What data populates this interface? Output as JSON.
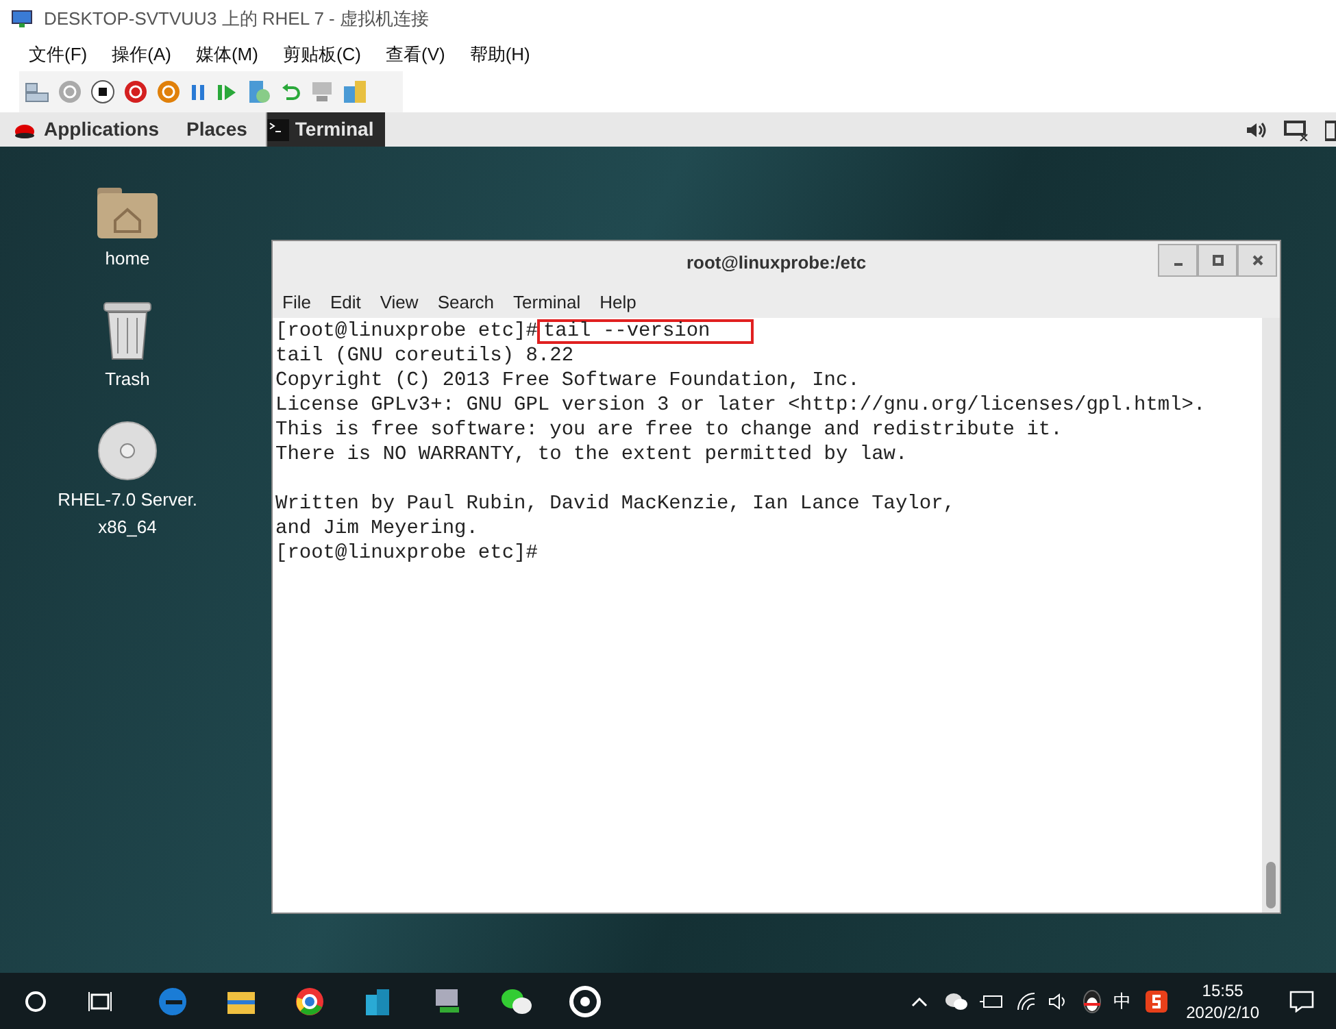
{
  "host_window": {
    "title": "DESKTOP-SVTVUU3 上的 RHEL 7 - 虚拟机连接",
    "menu": [
      "文件(F)",
      "操作(A)",
      "媒体(M)",
      "剪贴板(C)",
      "查看(V)",
      "帮助(H)"
    ]
  },
  "guest_top_bar": {
    "applications": "Applications",
    "places": "Places",
    "active_app": "Terminal"
  },
  "desktop_icons": [
    {
      "kind": "folder",
      "label": "home"
    },
    {
      "kind": "trash",
      "label": "Trash"
    },
    {
      "kind": "dvd",
      "label": "RHEL-7.0 Server. x86_64"
    }
  ],
  "terminal": {
    "title": "root@linuxprobe:/etc",
    "menu": [
      "File",
      "Edit",
      "View",
      "Search",
      "Terminal",
      "Help"
    ],
    "lines": [
      {
        "kind": "prompt",
        "prompt": "[root@linuxprobe etc]#",
        "command": "tail --version",
        "highlighted": true
      },
      {
        "kind": "output",
        "text": "tail (GNU coreutils) 8.22"
      },
      {
        "kind": "output",
        "text": "Copyright (C) 2013 Free Software Foundation, Inc."
      },
      {
        "kind": "output",
        "text": "License GPLv3+: GNU GPL version 3 or later <http://gnu.org/licenses/gpl.html>."
      },
      {
        "kind": "output",
        "text": "This is free software: you are free to change and redistribute it."
      },
      {
        "kind": "output",
        "text": "There is NO WARRANTY, to the extent permitted by law."
      },
      {
        "kind": "blank"
      },
      {
        "kind": "output",
        "text": "Written by Paul Rubin, David MacKenzie, Ian Lance Taylor,"
      },
      {
        "kind": "output",
        "text": "and Jim Meyering."
      },
      {
        "kind": "prompt",
        "prompt": "[root@linuxprobe etc]#"
      }
    ]
  },
  "taskbar": {
    "ime": "中",
    "time": "15:55",
    "date": "2020/2/10"
  }
}
